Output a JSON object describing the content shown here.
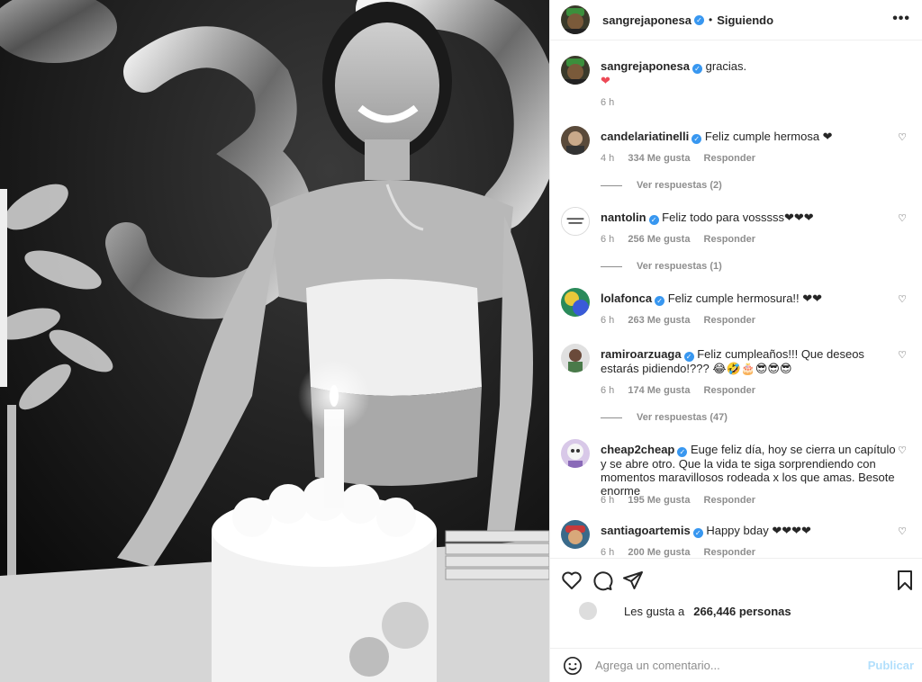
{
  "header": {
    "username": "sangrejaponesa",
    "separator": "•",
    "follow_status": "Siguiendo",
    "more": "•••"
  },
  "caption": {
    "username": "sangrejaponesa",
    "text": "gracias.",
    "emoji": "❤",
    "time": "6 h"
  },
  "comments": [
    {
      "username": "candelariatinelli",
      "text": "Feliz cumple hermosa ❤",
      "time": "4 h",
      "likes": "334 Me gusta",
      "reply": "Responder",
      "view_replies": "Ver respuestas (2)"
    },
    {
      "username": "nantolin",
      "text": "Feliz todo para vosssss❤❤❤",
      "time": "6 h",
      "likes": "256 Me gusta",
      "reply": "Responder",
      "view_replies": "Ver respuestas (1)"
    },
    {
      "username": "lolafonca",
      "text": "Feliz cumple hermosura!! ❤❤",
      "time": "6 h",
      "likes": "263 Me gusta",
      "reply": "Responder",
      "view_replies": ""
    },
    {
      "username": "ramiroarzuaga",
      "text": "Feliz cumpleaños!!! Que deseos estarás pidiendo!??? 😂🤣🎂😎😎😎",
      "time": "6 h",
      "likes": "174 Me gusta",
      "reply": "Responder",
      "view_replies": "Ver respuestas (47)"
    },
    {
      "username": "cheap2cheap",
      "text": "Euge feliz día, hoy se cierra un capítulo y se abre otro. Que la vida te siga sorprendiendo con momentos maravillosos rodeada x los que amas. Besote enorme",
      "time": "6 h",
      "likes": "195 Me gusta",
      "reply": "Responder",
      "view_replies": ""
    },
    {
      "username": "santiagoartemis",
      "text": "Happy bday ❤❤❤❤",
      "time": "6 h",
      "likes": "200 Me gusta",
      "reply": "Responder",
      "view_replies": ""
    }
  ],
  "actions": {
    "likes_label": "Les gusta a",
    "likes_count": "266,446 personas"
  },
  "add_comment": {
    "placeholder": "Agrega un comentario...",
    "publish": "Publicar"
  },
  "colors": {
    "verified": "#3897f0",
    "heart": "#ed4956",
    "publish_disabled": "#b2dffc"
  }
}
